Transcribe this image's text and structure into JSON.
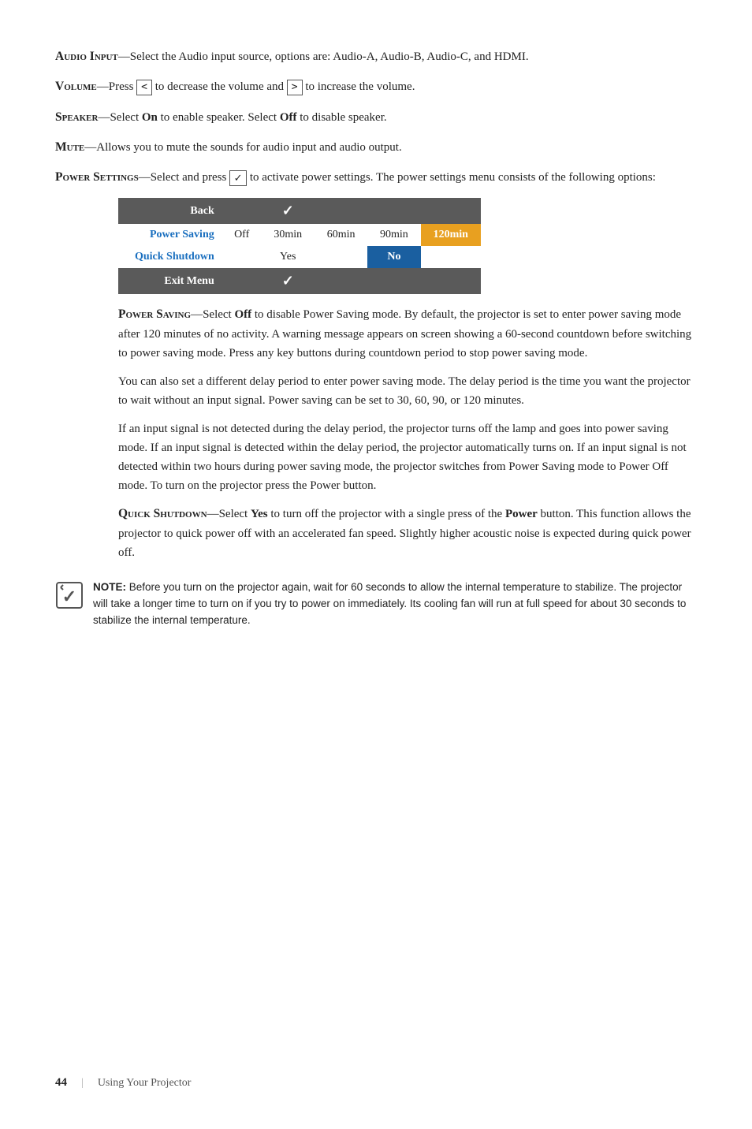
{
  "page": {
    "number": "44",
    "footer_label": "Using Your Projector"
  },
  "sections": {
    "audio_input": {
      "term": "Audio Input",
      "dash": "—",
      "text": "Select the Audio input source, options are: Audio-A, Audio-B, Audio-C, and HDMI."
    },
    "volume": {
      "term": "Volume",
      "dash": "—",
      "text_pre": "Press ",
      "btn_less": "<",
      "text_mid": " to decrease the volume and ",
      "btn_more": ">",
      "text_post": " to increase the volume."
    },
    "speaker": {
      "term": "Speaker",
      "dash": "—",
      "text_pre": "Select ",
      "on": "On",
      "text_mid": " to enable speaker. Select ",
      "off": "Off",
      "text_post": " to disable speaker."
    },
    "mute": {
      "term": "Mute",
      "dash": "—",
      "text": "Allows you to mute the sounds for audio input and audio output."
    },
    "power_settings": {
      "term": "Power Settings",
      "dash": "—",
      "text_pre": "Select and press ",
      "check_btn": "✓",
      "text_post": " to activate power settings. The power settings menu consists of the following options:"
    },
    "table": {
      "rows": [
        {
          "type": "back",
          "cells": [
            "Back",
            "",
            "✓",
            "",
            "",
            ""
          ]
        },
        {
          "type": "power",
          "label": "Power Saving",
          "cells": [
            "Off",
            "30min",
            "60min",
            "90min",
            "120min"
          ]
        },
        {
          "type": "shutdown",
          "label": "Quick Shutdown",
          "cells": [
            "",
            "Yes",
            "",
            "No",
            ""
          ]
        },
        {
          "type": "exit",
          "cells": [
            "Exit Menu",
            "",
            "✓",
            "",
            "",
            ""
          ]
        }
      ]
    },
    "power_saving_desc": {
      "term": "Power Saving",
      "dash": "—",
      "text_pre": "Select ",
      "off": "Off",
      "para1": " to disable Power Saving mode. By default, the projector is set to enter power saving mode after 120 minutes of no activity. A warning message appears on screen showing a 60-second countdown before switching to power saving mode. Press any key buttons during countdown period to stop power saving mode.",
      "para2": "You can also set a different delay period to enter power saving mode. The delay period is the time you want the projector to wait without an input signal. Power saving can be set to 30, 60, 90, or 120 minutes.",
      "para3": "If an input signal is not detected during the delay period, the projector turns off the lamp and goes into power saving mode. If an input signal is detected within the delay period, the projector automatically turns on. If an input signal is not detected within two hours during power saving mode, the projector switches from Power Saving mode to Power Off mode. To turn on the projector press the Power button."
    },
    "quick_shutdown_desc": {
      "term": "Quick Shutdown",
      "dash": "—",
      "text_pre": "Select ",
      "yes": "Yes",
      "text_mid": " to turn off the projector with a single press of the ",
      "power": "Power",
      "text_post": " button. This function allows the projector to quick power off with an accelerated fan speed. Slightly higher acoustic noise is expected during quick power off."
    },
    "note": {
      "label": "NOTE:",
      "text": " Before you turn on the projector again, wait for 60 seconds to allow the internal temperature to stabilize. The projector will take a longer time to turn on if you try to power on immediately. Its cooling fan will run at full speed for about 30 seconds to stabilize the internal temperature."
    }
  }
}
